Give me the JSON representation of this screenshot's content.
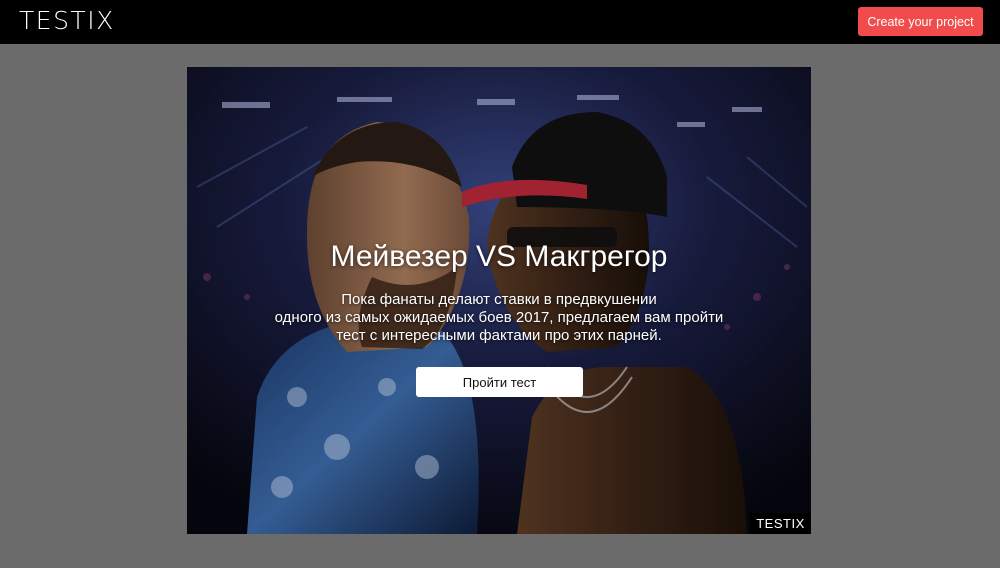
{
  "header": {
    "logo": "TESTIX",
    "cta_label": "Create your project",
    "cta_color": "#f24b4b"
  },
  "test": {
    "title": "Мейвезер VS Макгрегор",
    "description_lines": [
      "Пока фанаты делают ставки в предвкушении",
      "одного из самых ожидаемых боев 2017, предлагаем вам пройти",
      "тест с интересными фактами про этих парней."
    ],
    "start_label": "Пройти тест",
    "watermark": "TESTIX"
  }
}
